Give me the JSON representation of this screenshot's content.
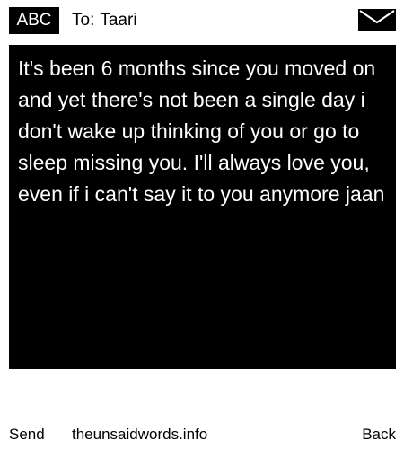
{
  "header": {
    "input_mode": "ABC",
    "recipient_label": "To:",
    "recipient_value": "Taari",
    "envelope_icon": "envelope-icon"
  },
  "message": {
    "body": "It's been 6 months since you moved on and yet there's not been a single day i don't wake up thinking of you or go to sleep missing you. I'll always love you, even if i can't say it to you anymore jaan"
  },
  "softkeys": {
    "left_label": "Send",
    "center_label": "theunsaidwords.info",
    "right_label": "Back"
  },
  "colors": {
    "background": "#ffffff",
    "message_background": "#000000",
    "message_text": "#ffffff",
    "text": "#000000"
  }
}
